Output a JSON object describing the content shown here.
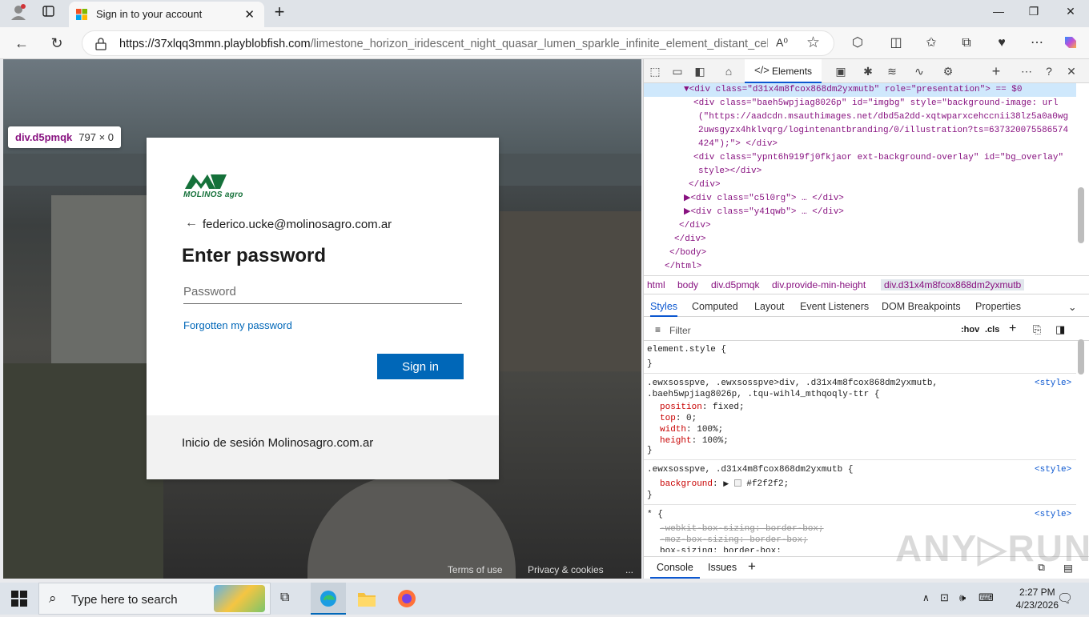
{
  "browser": {
    "tab_title": "Sign in to your account",
    "url_host": "https://37xlqq3mmn.playblobfish.com",
    "url_path": "/limestone_horizon_iridescent_night_quasar_lumen_sparkle_infinite_element_distant_celest...",
    "reader_label": "A⁰"
  },
  "inspect_tooltip": {
    "selector": "div.d5pmqk",
    "size": "797 × 0"
  },
  "login": {
    "brand": "MOLINOS agro",
    "email": "federico.ucke@molinosagro.com.ar",
    "heading": "Enter password",
    "password_placeholder": "Password",
    "forgot": "Forgotten my password",
    "signin": "Sign in",
    "footer": "Inicio de sesión Molinosagro.com.ar"
  },
  "page_footer": {
    "terms": "Terms of use",
    "privacy": "Privacy & cookies",
    "more": "..."
  },
  "devtools": {
    "elements_tab": "Elements",
    "dom": [
      {
        "indent": 6,
        "text": "▼<div class=\"d31x4m8fcox868dm2yxmutb\" role=\"presentation\"> == $0"
      },
      {
        "indent": 8,
        "text": "<div class=\"baeh5wpjiag8026p\" id=\"imgbg\" style=\"background-image: url"
      },
      {
        "indent": 9,
        "text": "(\"https://aadcdn.msauthimages.net/dbd5a2dd-xqtwparxcehccnii38lz5a0a0wg"
      },
      {
        "indent": 9,
        "text": "2uwsgyzx4hklvqrg/logintenantbranding/0/illustration?ts=637320075586574"
      },
      {
        "indent": 9,
        "text": "424\");\"> </div>"
      },
      {
        "indent": 8,
        "text": "<div class=\"ypnt6h919fj0fkjaor ext-background-overlay\" id=\"bg_overlay\""
      },
      {
        "indent": 9,
        "text": "style></div>"
      },
      {
        "indent": 7,
        "text": "</div>"
      },
      {
        "indent": 6,
        "text": "▶<div class=\"c5l0rg\"> … </div>"
      },
      {
        "indent": 6,
        "text": "▶<div class=\"y41qwb\"> … </div>"
      },
      {
        "indent": 5,
        "text": "</div>"
      },
      {
        "indent": 4,
        "text": "</div>"
      },
      {
        "indent": 3,
        "text": "</body>"
      },
      {
        "indent": 2,
        "text": "</html>"
      }
    ],
    "breadcrumbs": [
      "html",
      "body",
      "div.d5pmqk",
      "div.provide-min-height",
      "div.d31x4m8fcox868dm2yxmutb"
    ],
    "subtabs": [
      "Styles",
      "Computed",
      "Layout",
      "Event Listeners",
      "DOM Breakpoints",
      "Properties"
    ],
    "filter_placeholder": "Filter",
    "filter_tools": [
      ":hov",
      ".cls"
    ],
    "styles": {
      "element_style": "element.style {",
      "rule1_selector_a": ".ewxsosspve, .ewxsosspve>div, .d31x4m8fcox868dm2yxmutb,",
      "rule1_selector_b": ".baeh5wpjiag8026p, .tqu-wihl4_mthqoqly-ttr {",
      "rule1_props": [
        {
          "name": "position",
          "value": "fixed;"
        },
        {
          "name": "top",
          "value": "0;"
        },
        {
          "name": "width",
          "value": "100%;"
        },
        {
          "name": "height",
          "value": "100%;"
        }
      ],
      "rule2_selector": ".ewxsosspve, .d31x4m8fcox868dm2yxmutb {",
      "rule2_prop_name": "background",
      "rule2_prop_value": "#f2f2f2;",
      "rule3_selector": "* {",
      "rule3_props": [
        "-webkit-box-sizing: border-box;",
        "-moz-box-sizing: border-box;",
        "box-sizing: border-box;"
      ],
      "source": "<style>",
      "close": "}"
    },
    "console_tabs": [
      "Console",
      "Issues"
    ]
  },
  "taskbar": {
    "search_placeholder": "Type here to search",
    "time": "2:27 PM",
    "date": "4/23/2026"
  },
  "watermark": "ANY▷RUN",
  "colors": {
    "accent": "#0067b8",
    "brand_green": "#15713a",
    "selection": "#cfe8fc"
  }
}
